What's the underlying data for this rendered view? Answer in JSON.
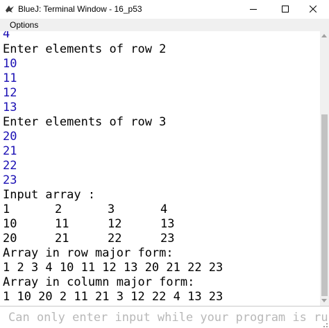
{
  "window": {
    "title": "BlueJ: Terminal Window - 16_p53"
  },
  "menu": {
    "options_label": "Options"
  },
  "terminal": {
    "text_color": "#000000",
    "input_color": "#1a0fb4",
    "lines": [
      {
        "text": "4",
        "kind": "input"
      },
      {
        "text": "Enter elements of row 2",
        "kind": "output"
      },
      {
        "text": "10",
        "kind": "input"
      },
      {
        "text": "11",
        "kind": "input"
      },
      {
        "text": "12",
        "kind": "input"
      },
      {
        "text": "13",
        "kind": "input"
      },
      {
        "text": "Enter elements of row 3",
        "kind": "output"
      },
      {
        "text": "20",
        "kind": "input"
      },
      {
        "text": "21",
        "kind": "input"
      },
      {
        "text": "22",
        "kind": "input"
      },
      {
        "text": "23",
        "kind": "input"
      },
      {
        "text": "Input array :",
        "kind": "output"
      },
      {
        "cells": [
          "1",
          "2",
          "3",
          "4"
        ],
        "kind": "output"
      },
      {
        "cells": [
          "10",
          "11",
          "12",
          "13"
        ],
        "kind": "output"
      },
      {
        "cells": [
          "20",
          "21",
          "22",
          "23"
        ],
        "kind": "output"
      },
      {
        "text": "Array in row major form:",
        "kind": "output"
      },
      {
        "text": "1 2 3 4 10 11 12 13 20 21 22 23",
        "kind": "output"
      },
      {
        "text": "Array in column major form:",
        "kind": "output"
      },
      {
        "text": "1 10 20 2 11 21 3 12 22 4 13 23",
        "kind": "output"
      }
    ]
  },
  "input_field": {
    "placeholder": "Can only enter input while your program is runni"
  },
  "icons": {
    "app": "bluej-bird-icon",
    "minimize": "minimize-icon",
    "maximize": "maximize-icon",
    "close": "close-icon"
  }
}
